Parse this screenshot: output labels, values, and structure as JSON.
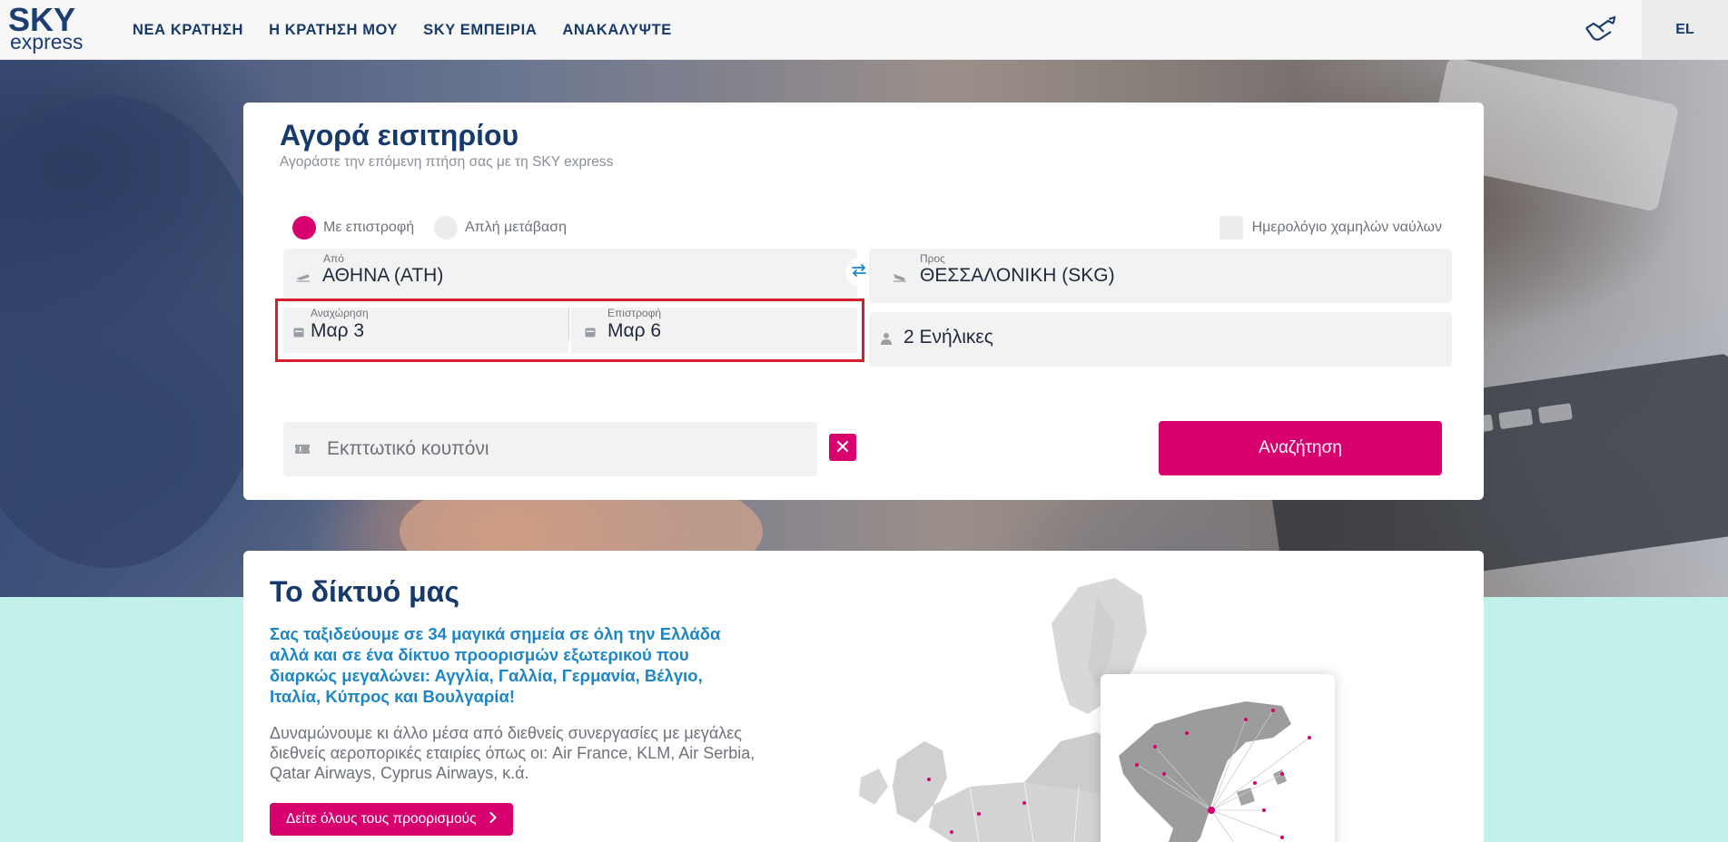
{
  "header": {
    "logo_top": "SKY",
    "logo_bottom": "express",
    "nav": [
      {
        "label": "ΝΕΑ ΚΡΑΤΗΣΗ"
      },
      {
        "label": "Η ΚΡΑΤΗΣΗ ΜΟΥ"
      },
      {
        "label": "SKY ΕΜΠΕΙΡΙΑ"
      },
      {
        "label": "ΑΝΑΚΑΛΥΨΤΕ"
      }
    ],
    "language": "EL"
  },
  "booking": {
    "title": "Αγορά εισιτηρίου",
    "subtitle": "Αγοράστε την επόμενη πτήση σας με τη SKY express",
    "trip_types": [
      {
        "label": "Με επιστροφή",
        "selected": true
      },
      {
        "label": "Απλή μετάβαση",
        "selected": false
      }
    ],
    "low_fare_calendar_label": "Ημερολόγιο χαμηλών ναύλων",
    "from": {
      "label": "Από",
      "value": "ΑΘΗΝΑ (ATH)"
    },
    "to": {
      "label": "Προς",
      "value": "ΘΕΣΣΑΛΟΝΙΚΗ (SKG)"
    },
    "departure": {
      "label": "Αναχώρηση",
      "value": "Μαρ 3"
    },
    "return": {
      "label": "Επιστροφή",
      "value": "Μαρ 6"
    },
    "passengers": "2 Ενήλικες",
    "coupon_placeholder": "Εκπτωτικό κουπόνι",
    "search_label": "Αναζήτηση"
  },
  "network": {
    "title": "Το δίκτυό μας",
    "lead": "Σας ταξιδεύουμε σε 34 μαγικά σημεία σε όλη την Ελλάδα αλλά και σε ένα δίκτυο προορισμών εξωτερικού που διαρκώς μεγαλώνει: Αγγλία, Γαλλία, Γερμανία, Βέλγιο, Ιταλία, Κύπρος και Βουλγαρία!",
    "body": "Δυναμώνουμε κι άλλο μέσα από διεθνείς συνεργασίες με μεγάλες διεθνείς αεροπορικές εταιρίες όπως οι: Air France, KLM, Air Serbia, Qatar Airways, Cyprus Airways, κ.ά.",
    "button_label": "Δείτε όλους τους προορισμούς"
  },
  "colors": {
    "brand_navy": "#163a6b",
    "accent_magenta": "#d8006f",
    "link_blue": "#1d86c6",
    "highlight_red": "#d81e2b",
    "section_bg": "#c2f0ea"
  }
}
